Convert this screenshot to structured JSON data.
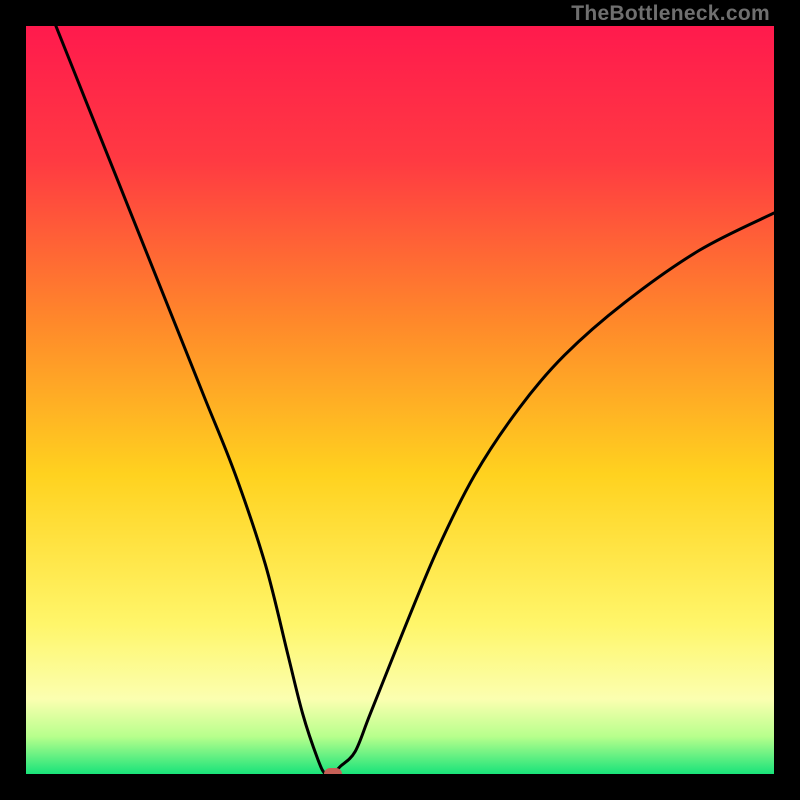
{
  "watermark": "TheBottleneck.com",
  "chart_data": {
    "type": "line",
    "title": "",
    "xlabel": "",
    "ylabel": "",
    "xlim": [
      0,
      100
    ],
    "ylim": [
      0,
      100
    ],
    "series": [
      {
        "name": "bottleneck-curve",
        "x": [
          4,
          8,
          12,
          16,
          20,
          24,
          28,
          32,
          35,
          37,
          39,
          40,
          41,
          42,
          44,
          46,
          50,
          55,
          60,
          66,
          72,
          80,
          90,
          100
        ],
        "y": [
          100,
          90,
          80,
          70,
          60,
          50,
          40,
          28,
          16,
          8,
          2,
          0,
          0,
          1,
          3,
          8,
          18,
          30,
          40,
          49,
          56,
          63,
          70,
          75
        ]
      }
    ],
    "marker": {
      "x": 41,
      "y": 0,
      "color": "#c66057"
    },
    "gradient_stops": [
      {
        "pct": 0,
        "color": "#ff1a4d"
      },
      {
        "pct": 18,
        "color": "#ff3a42"
      },
      {
        "pct": 40,
        "color": "#ff8a2a"
      },
      {
        "pct": 60,
        "color": "#ffd21f"
      },
      {
        "pct": 80,
        "color": "#fff66a"
      },
      {
        "pct": 90,
        "color": "#fbffb0"
      },
      {
        "pct": 95,
        "color": "#b7ff8c"
      },
      {
        "pct": 100,
        "color": "#19e37a"
      }
    ]
  }
}
